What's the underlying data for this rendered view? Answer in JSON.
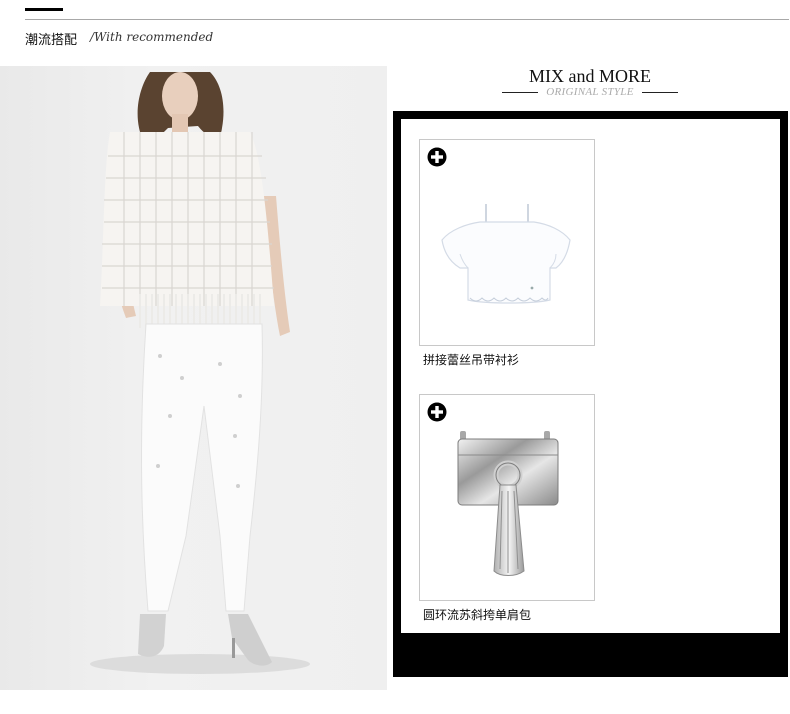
{
  "header": {
    "title": "潮流搭配",
    "subtitle": "/With recommended"
  },
  "model_photo": {
    "icon": "model-photo"
  },
  "mix": {
    "title": "MIX and MORE",
    "subtitle": "ORIGINAL STYLE"
  },
  "products": [
    {
      "name": "拼接蕾丝吊带衬衫",
      "icon": "white-top-image"
    },
    {
      "name": "圆环流苏斜挎单肩包",
      "icon": "silver-bag-image"
    }
  ],
  "colors": {
    "frame": "#000000",
    "card_border": "#c8c8c8"
  }
}
